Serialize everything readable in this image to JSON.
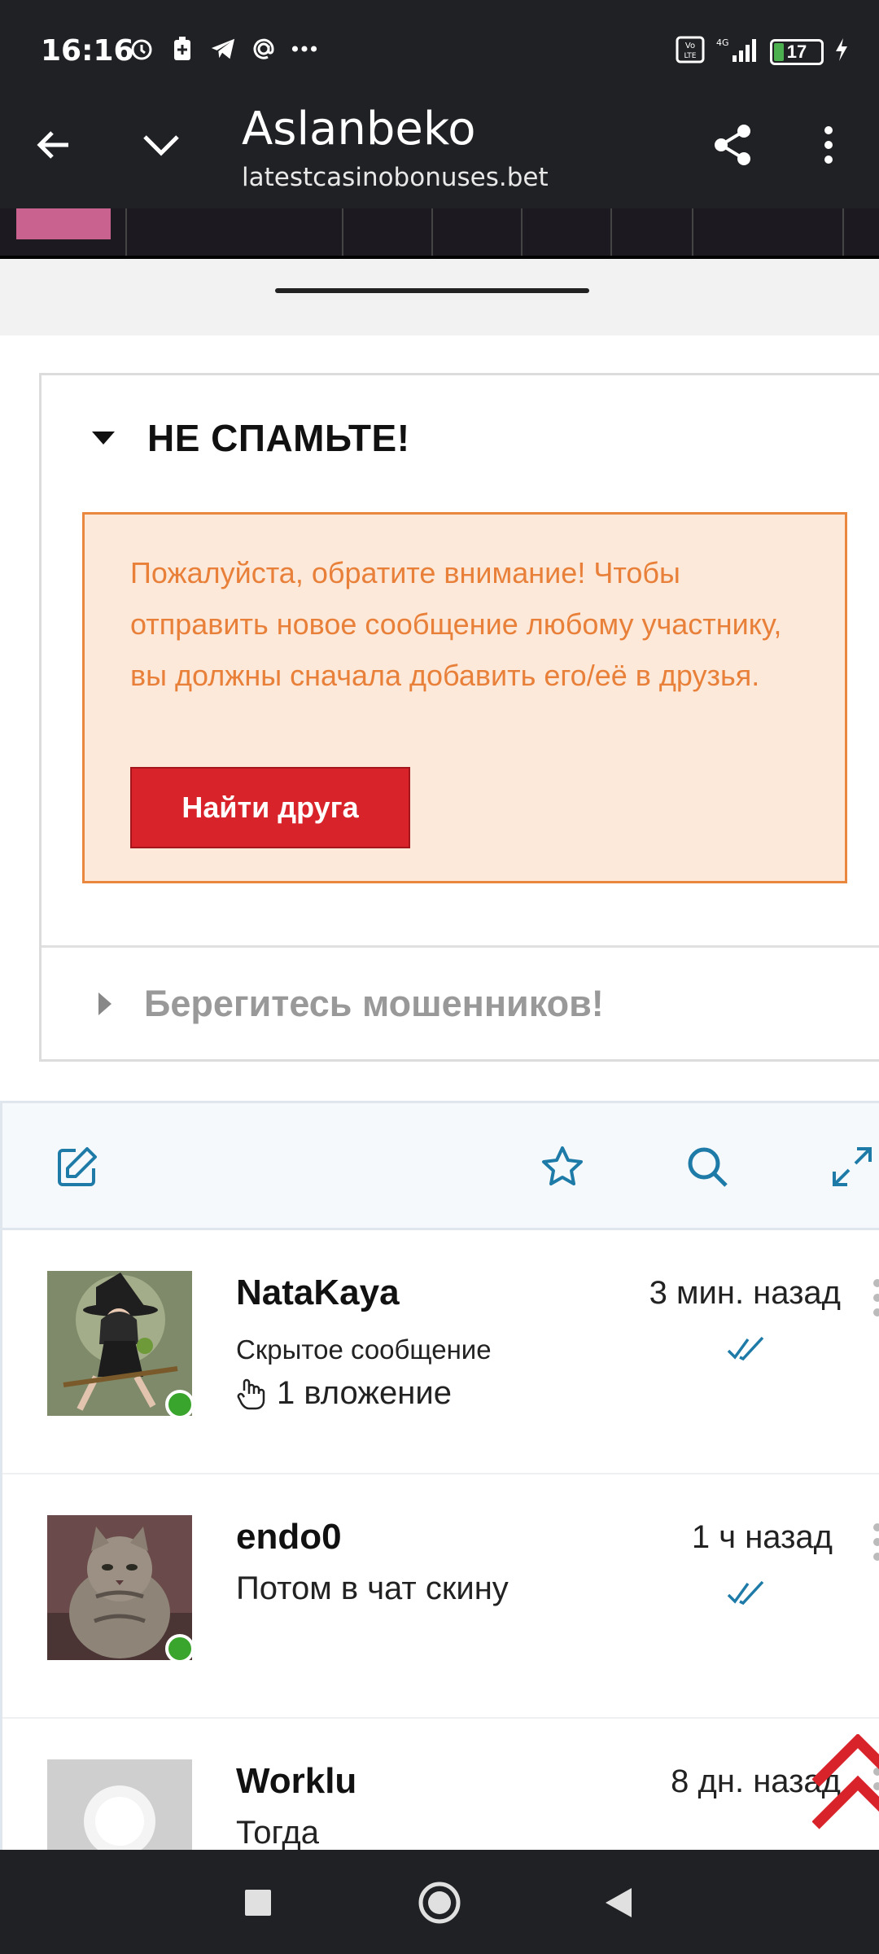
{
  "status_bar": {
    "time": "16:16",
    "left_icons": [
      "alarm-icon",
      "battery-saver-icon",
      "telegram-icon",
      "at-icon",
      "more-dots-icon"
    ],
    "battery_level": "17",
    "network": "4G"
  },
  "toolbar": {
    "title": "Aslanbeko",
    "url": "latestcasinobonuses.bet"
  },
  "accordion": {
    "section1_title": "НЕ СПАМЬТЕ!",
    "notice_text": "Пожалуйста, обратите внимание! Чтобы отправить новое сообщение любому участнику, вы должны сначала добавить его/её в друзья.",
    "find_friend_button": "Найти друга",
    "section2_title": "Берегитесь мошенников!"
  },
  "messages": [
    {
      "name": "NataKaya",
      "preview": "Скрытое сообщение",
      "attachment": "1 вложение",
      "time": "3 мин. назад",
      "online": true
    },
    {
      "name": "endo0",
      "preview": "Потом в чат скину",
      "time": "1 ч назад",
      "online": true
    },
    {
      "name": "Worklu",
      "preview": "Тогда",
      "time": "8 дн. назад",
      "online": false
    }
  ],
  "colors": {
    "accent_blue": "#1e7ba8",
    "notice_bg": "#fde9d9",
    "notice_text": "#e8803a",
    "button_red": "#d9232b",
    "online_green": "#3aa52c",
    "dark_bar": "#202124"
  }
}
